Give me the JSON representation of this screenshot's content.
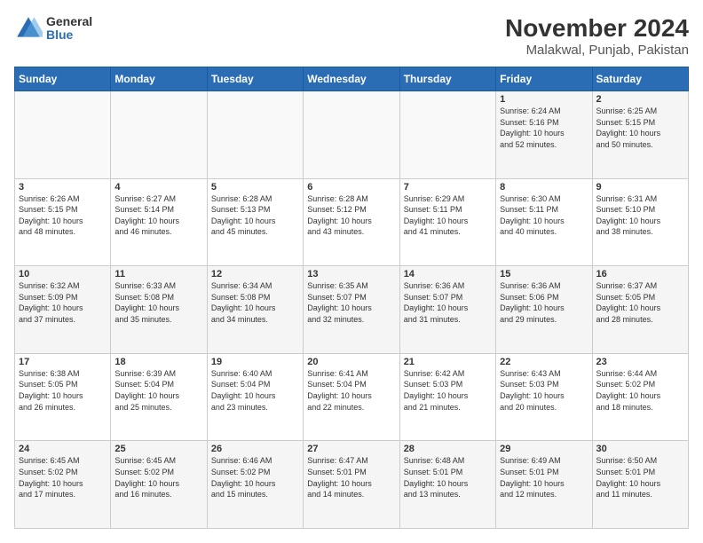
{
  "header": {
    "logo_general": "General",
    "logo_blue": "Blue",
    "title": "November 2024",
    "subtitle": "Malakwal, Punjab, Pakistan"
  },
  "days_of_week": [
    "Sunday",
    "Monday",
    "Tuesday",
    "Wednesday",
    "Thursday",
    "Friday",
    "Saturday"
  ],
  "weeks": [
    [
      {
        "day": "",
        "info": ""
      },
      {
        "day": "",
        "info": ""
      },
      {
        "day": "",
        "info": ""
      },
      {
        "day": "",
        "info": ""
      },
      {
        "day": "",
        "info": ""
      },
      {
        "day": "1",
        "info": "Sunrise: 6:24 AM\nSunset: 5:16 PM\nDaylight: 10 hours\nand 52 minutes."
      },
      {
        "day": "2",
        "info": "Sunrise: 6:25 AM\nSunset: 5:15 PM\nDaylight: 10 hours\nand 50 minutes."
      }
    ],
    [
      {
        "day": "3",
        "info": "Sunrise: 6:26 AM\nSunset: 5:15 PM\nDaylight: 10 hours\nand 48 minutes."
      },
      {
        "day": "4",
        "info": "Sunrise: 6:27 AM\nSunset: 5:14 PM\nDaylight: 10 hours\nand 46 minutes."
      },
      {
        "day": "5",
        "info": "Sunrise: 6:28 AM\nSunset: 5:13 PM\nDaylight: 10 hours\nand 45 minutes."
      },
      {
        "day": "6",
        "info": "Sunrise: 6:28 AM\nSunset: 5:12 PM\nDaylight: 10 hours\nand 43 minutes."
      },
      {
        "day": "7",
        "info": "Sunrise: 6:29 AM\nSunset: 5:11 PM\nDaylight: 10 hours\nand 41 minutes."
      },
      {
        "day": "8",
        "info": "Sunrise: 6:30 AM\nSunset: 5:11 PM\nDaylight: 10 hours\nand 40 minutes."
      },
      {
        "day": "9",
        "info": "Sunrise: 6:31 AM\nSunset: 5:10 PM\nDaylight: 10 hours\nand 38 minutes."
      }
    ],
    [
      {
        "day": "10",
        "info": "Sunrise: 6:32 AM\nSunset: 5:09 PM\nDaylight: 10 hours\nand 37 minutes."
      },
      {
        "day": "11",
        "info": "Sunrise: 6:33 AM\nSunset: 5:08 PM\nDaylight: 10 hours\nand 35 minutes."
      },
      {
        "day": "12",
        "info": "Sunrise: 6:34 AM\nSunset: 5:08 PM\nDaylight: 10 hours\nand 34 minutes."
      },
      {
        "day": "13",
        "info": "Sunrise: 6:35 AM\nSunset: 5:07 PM\nDaylight: 10 hours\nand 32 minutes."
      },
      {
        "day": "14",
        "info": "Sunrise: 6:36 AM\nSunset: 5:07 PM\nDaylight: 10 hours\nand 31 minutes."
      },
      {
        "day": "15",
        "info": "Sunrise: 6:36 AM\nSunset: 5:06 PM\nDaylight: 10 hours\nand 29 minutes."
      },
      {
        "day": "16",
        "info": "Sunrise: 6:37 AM\nSunset: 5:05 PM\nDaylight: 10 hours\nand 28 minutes."
      }
    ],
    [
      {
        "day": "17",
        "info": "Sunrise: 6:38 AM\nSunset: 5:05 PM\nDaylight: 10 hours\nand 26 minutes."
      },
      {
        "day": "18",
        "info": "Sunrise: 6:39 AM\nSunset: 5:04 PM\nDaylight: 10 hours\nand 25 minutes."
      },
      {
        "day": "19",
        "info": "Sunrise: 6:40 AM\nSunset: 5:04 PM\nDaylight: 10 hours\nand 23 minutes."
      },
      {
        "day": "20",
        "info": "Sunrise: 6:41 AM\nSunset: 5:04 PM\nDaylight: 10 hours\nand 22 minutes."
      },
      {
        "day": "21",
        "info": "Sunrise: 6:42 AM\nSunset: 5:03 PM\nDaylight: 10 hours\nand 21 minutes."
      },
      {
        "day": "22",
        "info": "Sunrise: 6:43 AM\nSunset: 5:03 PM\nDaylight: 10 hours\nand 20 minutes."
      },
      {
        "day": "23",
        "info": "Sunrise: 6:44 AM\nSunset: 5:02 PM\nDaylight: 10 hours\nand 18 minutes."
      }
    ],
    [
      {
        "day": "24",
        "info": "Sunrise: 6:45 AM\nSunset: 5:02 PM\nDaylight: 10 hours\nand 17 minutes."
      },
      {
        "day": "25",
        "info": "Sunrise: 6:45 AM\nSunset: 5:02 PM\nDaylight: 10 hours\nand 16 minutes."
      },
      {
        "day": "26",
        "info": "Sunrise: 6:46 AM\nSunset: 5:02 PM\nDaylight: 10 hours\nand 15 minutes."
      },
      {
        "day": "27",
        "info": "Sunrise: 6:47 AM\nSunset: 5:01 PM\nDaylight: 10 hours\nand 14 minutes."
      },
      {
        "day": "28",
        "info": "Sunrise: 6:48 AM\nSunset: 5:01 PM\nDaylight: 10 hours\nand 13 minutes."
      },
      {
        "day": "29",
        "info": "Sunrise: 6:49 AM\nSunset: 5:01 PM\nDaylight: 10 hours\nand 12 minutes."
      },
      {
        "day": "30",
        "info": "Sunrise: 6:50 AM\nSunset: 5:01 PM\nDaylight: 10 hours\nand 11 minutes."
      }
    ]
  ]
}
